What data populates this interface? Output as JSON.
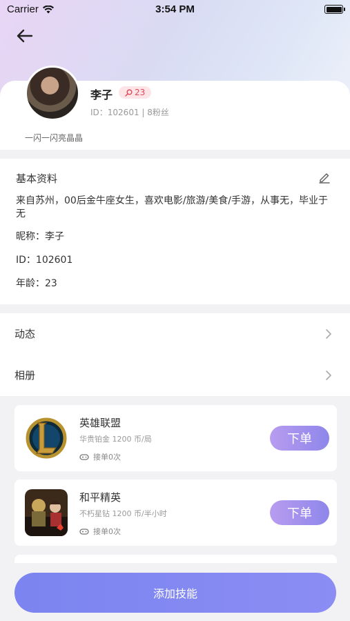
{
  "status_bar": {
    "carrier": "Carrier",
    "time": "3:54 PM"
  },
  "profile": {
    "name": "李子",
    "badge": "23",
    "id_line": "ID：102601 | 8粉丝",
    "signature": "一闪一闪亮晶晶"
  },
  "basic_info": {
    "title": "基本资料",
    "description": "来自苏州，00后金牛座女生，喜欢电影/旅游/美食/手游，从事无，毕业于无",
    "nickname": "昵称：李子",
    "id": "ID：102601",
    "age": "年龄：23"
  },
  "menu": {
    "items": [
      {
        "label": "动态"
      },
      {
        "label": "相册"
      }
    ]
  },
  "skills": [
    {
      "name": "英雄联盟",
      "meta": "华贵铂金  1200 币/局",
      "orders": "接单0次",
      "button": "下单"
    },
    {
      "name": "和平精英",
      "meta": "不朽星钻  1200 币/半小时",
      "orders": "接单0次",
      "button": "下单"
    }
  ],
  "add_skill_label": "添加技能",
  "colors": {
    "accent": "#8b8df3",
    "badge_text": "#e04858",
    "badge_bg": "#fde4e6"
  }
}
